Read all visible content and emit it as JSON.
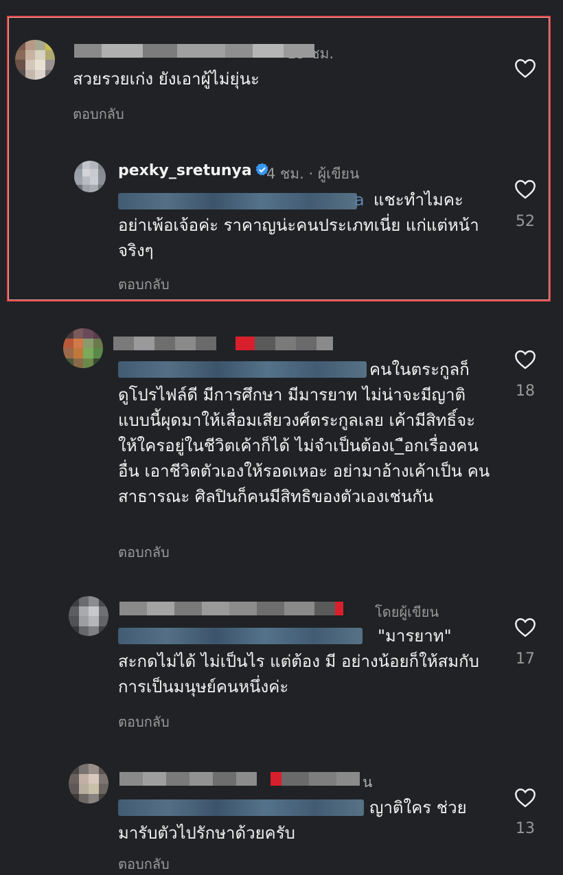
{
  "comments": [
    {
      "time": "19 ชม.",
      "text": "สวยรวยเก่ง ยังเอาผู้ไม่ยุ่นะ",
      "reply_label": "ตอบกลับ"
    },
    {
      "username": "pexky_sretunya",
      "time_author": "4 ชม. · ผู้เขียน",
      "mention_tail": "a",
      "text_line1": "แชะทำไมคะ",
      "text_rest": "อย่าเพ้อเจ้อค่ะ  ราคาญน่ะคนประเภทเนี่ย  แก่แต่หน้าจริงๆ",
      "reply_label": "ตอบกลับ",
      "likes": "52"
    },
    {
      "text_line1": "คนในตระกูลก็",
      "text_rest": "ดูโปรไฟล์ดี มีการศึกษา มีมารยาท ไม่น่าจะมีญาติแบบนี้ผุดมาให้เสื่อมเสียวงศ์ตระกูลเลย เค้ามีสิทธิ์จะให้ใครอยู่ในชีวิตเค้าก็ได้ ไม่จำเป็นต้องเ_ือกเรื่องคนอื่น  เอาชีวิตตัวเองให้รอดเหอะ อย่ามาอ้างเค้าเป็น คนสาธารณะ ศิลปินก็คนมีสิทธิของตัวเองเช่นกัน",
      "reply_label": "ตอบกลับ",
      "likes": "18"
    },
    {
      "liked_by_author": "โดยผู้เขียน",
      "text_line1": "\"มารยาท\"",
      "text_rest": "สะกดไม่ได้ ไม่เป็นไร  แต่ต้อง มี อย่างน้อยก็ให้สมกับการเป็นมนุษย์คนหนึ่งค่ะ",
      "reply_label": "ตอบกลับ",
      "likes": "17"
    },
    {
      "name_tail": "น",
      "text_line1": "ญาติใคร ช่วย",
      "text_rest": "มารับตัวไปรักษาด้วยครับ",
      "reply_label": "ตอบกลับ",
      "likes": "13"
    }
  ],
  "colors": {
    "background": "#202225",
    "highlight": "#e04848",
    "verified": "#3897f0",
    "meta_text": "#9a9a9a",
    "mention": "#4a6680"
  },
  "icons": [
    "heart-outline-icon",
    "verified-badge-icon"
  ]
}
